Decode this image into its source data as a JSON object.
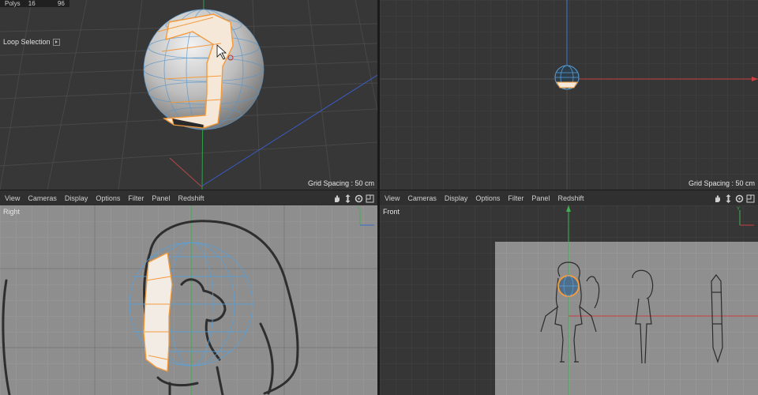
{
  "viewports": {
    "top_left": {
      "hud": {
        "polys_label": "Polys",
        "polys_selected": "16",
        "polys_total": "96"
      },
      "tool_label": "Loop Selection",
      "grid_spacing": "Grid Spacing : 50 cm"
    },
    "top_right": {
      "grid_spacing": "Grid Spacing : 50 cm"
    },
    "bottom_left": {
      "name": "Right",
      "menu": [
        "View",
        "Cameras",
        "Display",
        "Options",
        "Filter",
        "Panel",
        "Redshift"
      ]
    },
    "bottom_right": {
      "name": "Front",
      "menu": [
        "View",
        "Cameras",
        "Display",
        "Options",
        "Filter",
        "Panel",
        "Redshift"
      ]
    }
  },
  "nav_icons": [
    "move-hand-icon",
    "zoom-arrows-icon",
    "rotate-icon",
    "maximize-icon"
  ],
  "colors": {
    "viewport_bg": "#3a3a3a",
    "grid_line": "#4a4a4a",
    "selection": "#f39a3c",
    "wireframe": "#5aa0d8",
    "axis_x": "#d0403c",
    "axis_y": "#40b050",
    "axis_z": "#3c6ad0"
  }
}
